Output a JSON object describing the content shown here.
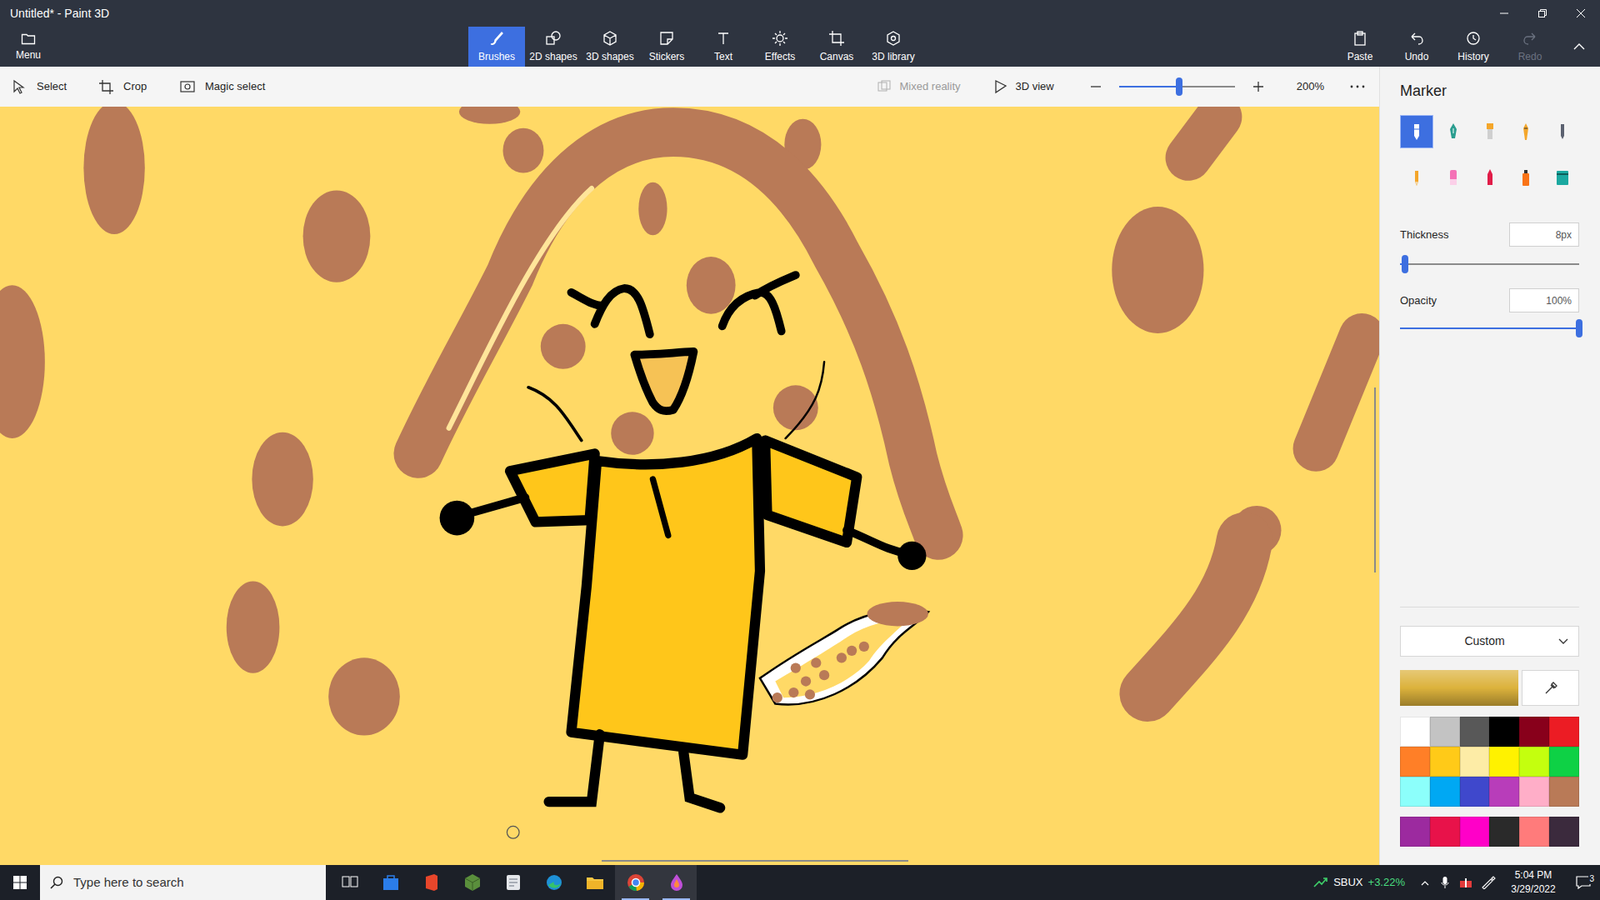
{
  "window": {
    "title": "Untitled* - Paint 3D"
  },
  "menu": {
    "label": "Menu"
  },
  "tabs": [
    {
      "label": "Brushes",
      "selected": true
    },
    {
      "label": "2D shapes",
      "selected": false
    },
    {
      "label": "3D shapes",
      "selected": false
    },
    {
      "label": "Stickers",
      "selected": false
    },
    {
      "label": "Text",
      "selected": false
    },
    {
      "label": "Effects",
      "selected": false
    },
    {
      "label": "Canvas",
      "selected": false
    },
    {
      "label": "3D library",
      "selected": false
    }
  ],
  "actions": [
    {
      "label": "Paste",
      "disabled": false
    },
    {
      "label": "Undo",
      "disabled": false
    },
    {
      "label": "History",
      "disabled": false
    },
    {
      "label": "Redo",
      "disabled": true
    }
  ],
  "tools": [
    {
      "label": "Select"
    },
    {
      "label": "Crop"
    },
    {
      "label": "Magic select"
    }
  ],
  "view": {
    "mixed_reality": {
      "label": "Mixed reality",
      "disabled": true
    },
    "view_3d": {
      "label": "3D view"
    },
    "zoom": {
      "level": 0.52,
      "reading": "200%"
    }
  },
  "panel": {
    "title": "Marker",
    "brushes": [
      {
        "selected": true
      },
      {
        "selected": false
      },
      {
        "selected": false
      },
      {
        "selected": false
      },
      {
        "selected": false
      },
      {
        "selected": false
      },
      {
        "selected": false
      },
      {
        "selected": false
      },
      {
        "selected": false
      },
      {
        "selected": false
      }
    ],
    "thickness": {
      "label": "Thickness",
      "value": "8px",
      "level": 0.03
    },
    "opacity": {
      "label": "Opacity",
      "value": "100%",
      "level": 1
    },
    "color_mode": {
      "label": "Custom"
    },
    "current_color": {
      "color": "#dcb23c"
    },
    "palette": [
      [
        {
          "color": "#ffffff"
        },
        {
          "color": "#c3c3c3"
        },
        {
          "color": "#585858"
        },
        {
          "color": "#000000"
        },
        {
          "color": "#88001b"
        },
        {
          "color": "#ec1c24"
        }
      ],
      [
        {
          "color": "#ff7f27"
        },
        {
          "color": "#ffca18"
        },
        {
          "color": "#fdeca6"
        },
        {
          "color": "#fff200"
        },
        {
          "color": "#c4ff0e"
        },
        {
          "color": "#0ed145"
        }
      ],
      [
        {
          "color": "#8cfffb"
        },
        {
          "color": "#00a8f3"
        },
        {
          "color": "#3f48cc"
        },
        {
          "color": "#b83dba"
        },
        {
          "color": "#ffaec8"
        },
        {
          "color": "#b97a57"
        }
      ],
      [
        {
          "color": "#9c2a9f"
        },
        {
          "color": "#e8124a"
        },
        {
          "color": "#ff00c8"
        },
        {
          "color": "#2a2a2a"
        },
        {
          "color": "#ff7b7b"
        },
        {
          "color": "#3b2a3d"
        }
      ]
    ]
  },
  "taskbar": {
    "search": {
      "placeholder": "Type here to search"
    },
    "apps": [
      {
        "active": false
      },
      {
        "active": false
      },
      {
        "active": false
      },
      {
        "active": false
      },
      {
        "active": false
      },
      {
        "active": false
      },
      {
        "active": false
      },
      {
        "active": true
      },
      {
        "active": true
      }
    ],
    "stock": {
      "symbol": "SBUX",
      "change": "+3.22%"
    },
    "clock": {
      "time": "5:04 PM",
      "date": "3/29/2022"
    },
    "notifications": {
      "count": "3"
    }
  }
}
